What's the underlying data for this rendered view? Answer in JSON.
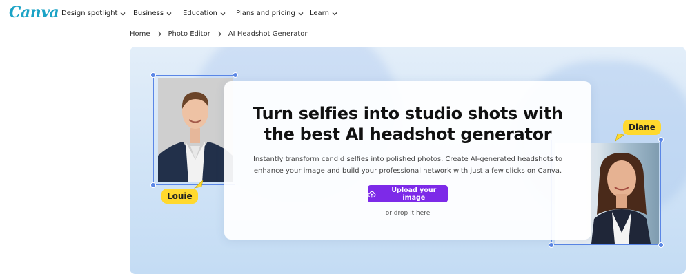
{
  "brand": {
    "logo": "Canva"
  },
  "nav": {
    "items": [
      {
        "label": "Design spotlight"
      },
      {
        "label": "Business"
      },
      {
        "label": "Education"
      },
      {
        "label": "Plans and pricing"
      },
      {
        "label": "Learn"
      }
    ]
  },
  "breadcrumb": {
    "items": [
      {
        "label": "Home"
      },
      {
        "label": "Photo Editor"
      },
      {
        "label": "AI Headshot Generator"
      }
    ]
  },
  "hero": {
    "headline": "Turn selfies into studio shots with the best AI headshot generator",
    "subtext": "Instantly transform candid selfies into polished photos. Create AI-generated headshots to enhance your image and build your professional network with just a few clicks on Canva.",
    "upload_label": "Upload your image",
    "drop_label": "or drop it here",
    "left_tag": "Louie",
    "right_tag": "Diane"
  },
  "colors": {
    "brand": "#1ba3c6",
    "accent_purple": "#7d2ae8",
    "tag_yellow": "#ffd92e",
    "selection_blue": "#5a86e6"
  }
}
